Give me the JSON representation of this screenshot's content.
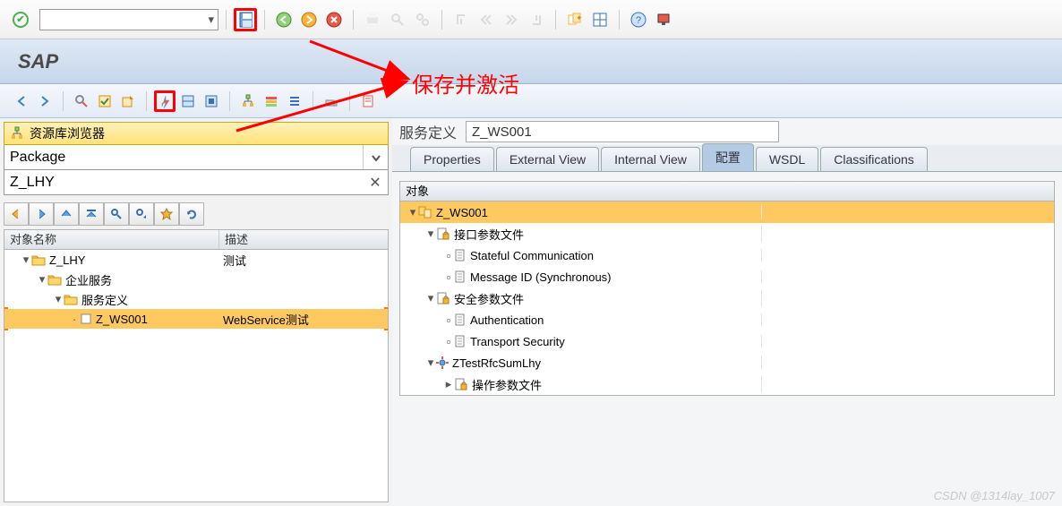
{
  "app_title": "SAP",
  "annotation": "保存并激活",
  "repo": {
    "title": "资源库浏览器",
    "type_value": "Package",
    "package_value": "Z_LHY"
  },
  "tree": {
    "col_name": "对象名称",
    "col_desc": "描述",
    "rows": [
      {
        "indent": 1,
        "open": true,
        "icon": "folder-open",
        "name": "Z_LHY",
        "desc": "测试"
      },
      {
        "indent": 2,
        "open": true,
        "icon": "folder-open",
        "name": "企业服务",
        "desc": ""
      },
      {
        "indent": 3,
        "open": true,
        "icon": "folder-open",
        "name": "服务定义",
        "desc": ""
      },
      {
        "indent": 4,
        "open": false,
        "icon": "leaf",
        "name": "Z_WS001",
        "desc": "WebService测试",
        "selected": true
      }
    ]
  },
  "service": {
    "label": "服务定义",
    "name": "Z_WS001"
  },
  "tabs": {
    "items": [
      "Properties",
      "External View",
      "Internal View",
      "配置",
      "WSDL",
      "Classifications"
    ],
    "active": 3
  },
  "cfg": {
    "header": "对象",
    "rows": [
      {
        "indent": 0,
        "tgl": "▾",
        "icon": "svc",
        "label": "Z_WS001",
        "hl": true
      },
      {
        "indent": 1,
        "tgl": "▾",
        "icon": "doc-lock",
        "label": "接口参数文件"
      },
      {
        "indent": 2,
        "tgl": "▫",
        "icon": "doc",
        "label": "Stateful Communication"
      },
      {
        "indent": 2,
        "tgl": "▫",
        "icon": "doc",
        "label": "Message ID (Synchronous)"
      },
      {
        "indent": 1,
        "tgl": "▾",
        "icon": "doc-lock",
        "label": "安全参数文件"
      },
      {
        "indent": 2,
        "tgl": "▫",
        "icon": "doc",
        "label": "Authentication"
      },
      {
        "indent": 2,
        "tgl": "▫",
        "icon": "doc",
        "label": "Transport Security"
      },
      {
        "indent": 1,
        "tgl": "▾",
        "icon": "gear",
        "label": "ZTestRfcSumLhy"
      },
      {
        "indent": 2,
        "tgl": "▸",
        "icon": "doc-lock",
        "label": "操作参数文件"
      }
    ]
  },
  "watermark": "CSDN @1314lay_1007"
}
